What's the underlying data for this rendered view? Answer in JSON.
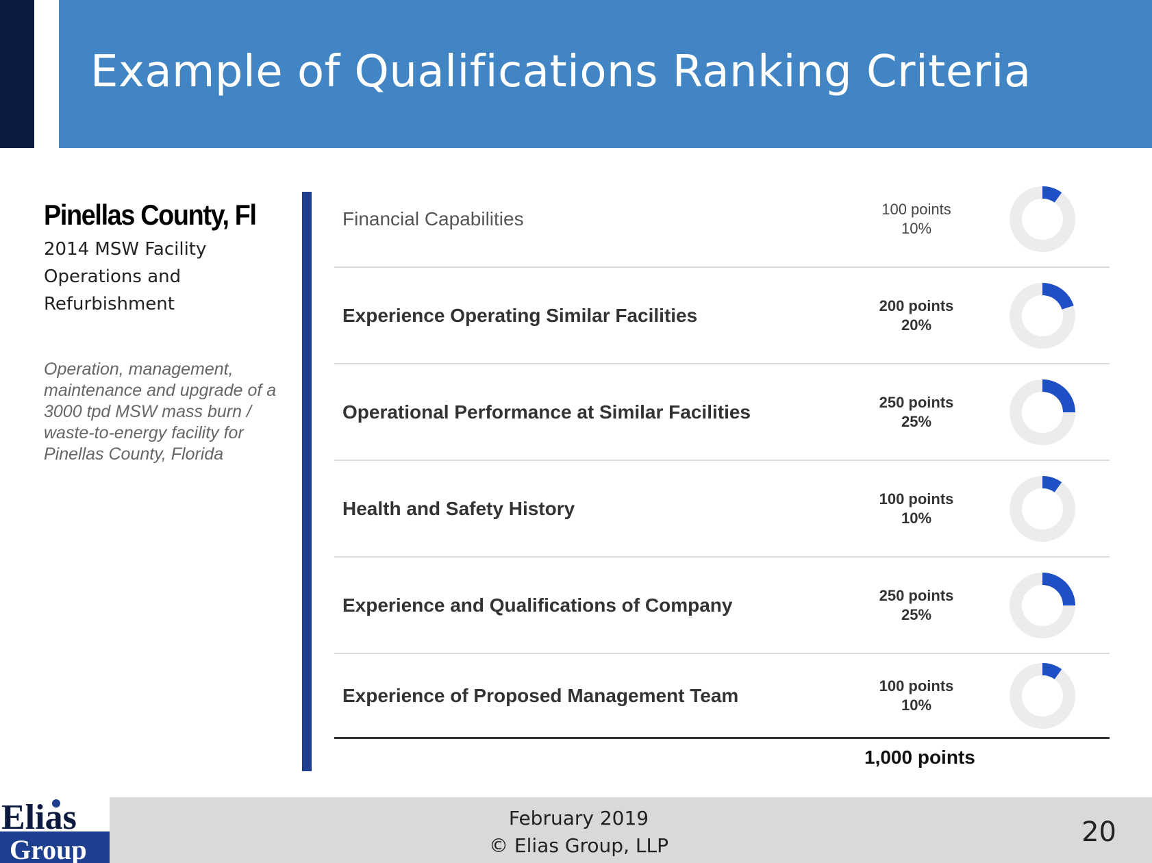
{
  "title": "Example of Qualifications Ranking Criteria",
  "sidebar": {
    "county": "Pinellas County, Fl",
    "facility": "2014 MSW Facility Operations and Refurbishment",
    "description": "Operation, management, maintenance and upgrade of a 3000 tpd MSW mass burn / waste-to-energy facility for Pinellas County, Florida"
  },
  "criteria": [
    {
      "name": "Financial Capabilities",
      "points": "100 points",
      "percent": "10%",
      "share": 0.1
    },
    {
      "name": "Experience Operating Similar Facilities",
      "points": "200 points",
      "percent": "20%",
      "share": 0.2
    },
    {
      "name": "Operational Performance at Similar Facilities",
      "points": "250 points",
      "percent": "25%",
      "share": 0.25
    },
    {
      "name": "Health and Safety History",
      "points": "100 points",
      "percent": "10%",
      "share": 0.1
    },
    {
      "name": "Experience and Qualifications of Company",
      "points": "250 points",
      "percent": "25%",
      "share": 0.25
    },
    {
      "name": "Experience of Proposed Management Team",
      "points": "100 points",
      "percent": "10%",
      "share": 0.1
    }
  ],
  "total": "1,000 points",
  "footer": {
    "date": "February 2019",
    "copyright": "© Elias Group, LLP",
    "page_number": "20"
  },
  "logo": {
    "line1": "Elias",
    "line2": "Group"
  },
  "colors": {
    "banner": "#4185c5",
    "dark_accent": "#0c1a3f",
    "divider": "#1d3f8e",
    "donut_fill": "#1f4fc4",
    "donut_track": "#ececec"
  }
}
